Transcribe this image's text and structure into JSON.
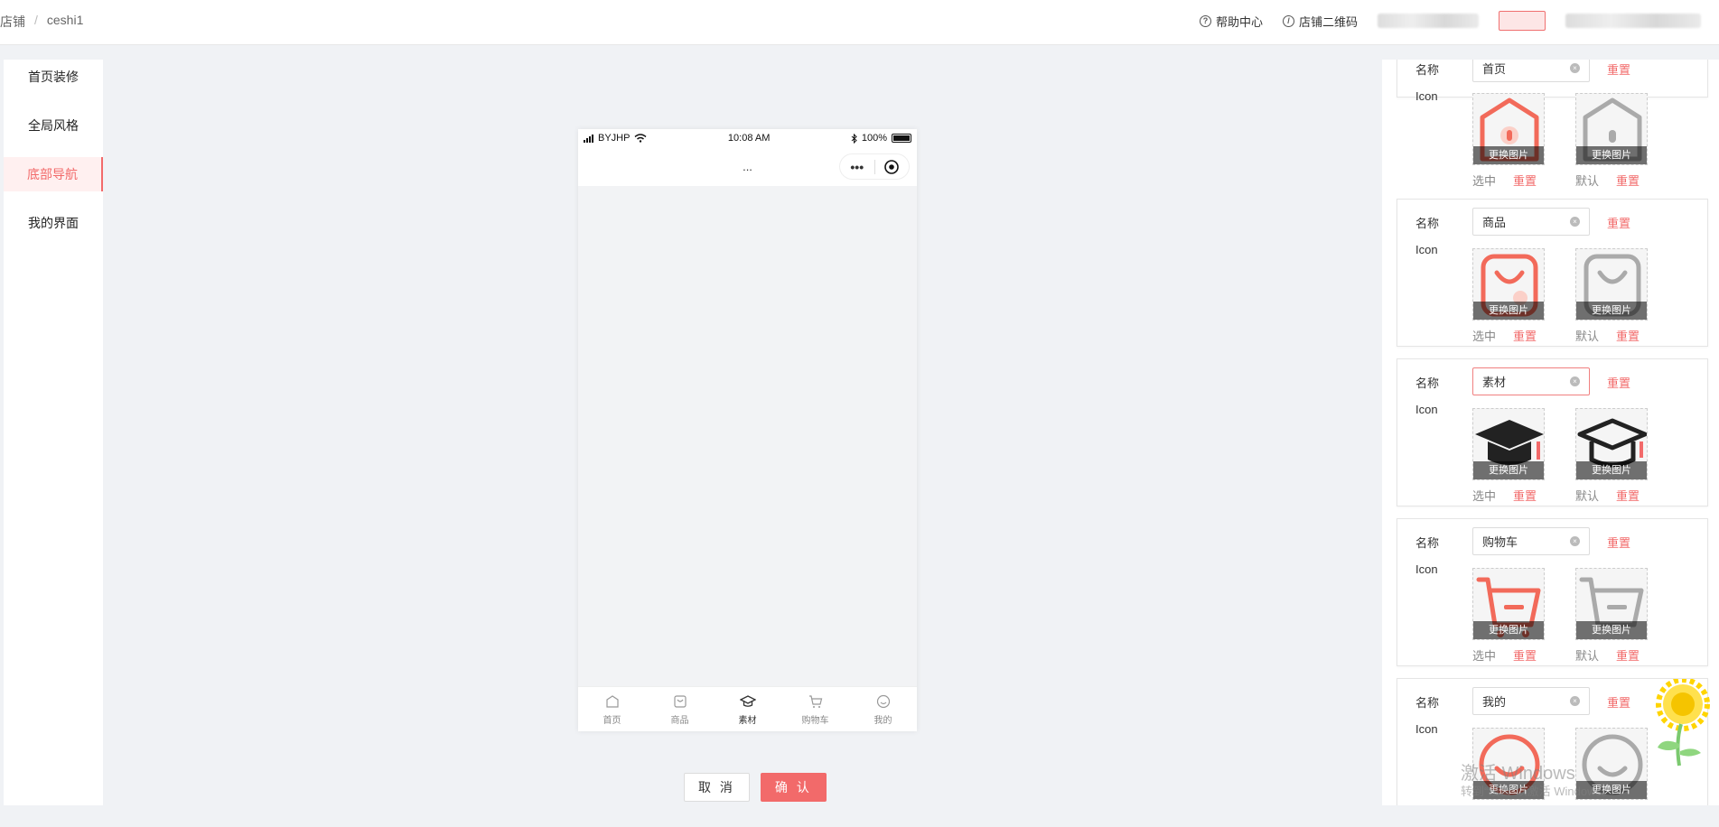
{
  "breadcrumb": {
    "shop": "店铺",
    "sep": "/",
    "page": "ceshi1"
  },
  "header": {
    "help": "帮助中心",
    "qrcode": "店铺二维码"
  },
  "sidebar": {
    "items": [
      {
        "label": "首页装修"
      },
      {
        "label": "全局风格"
      },
      {
        "label": "底部导航",
        "active": true
      },
      {
        "label": "我的界面"
      }
    ]
  },
  "phone": {
    "carrier": "BYJHP",
    "time": "10:08 AM",
    "battery": "100%",
    "nav_title": "...",
    "capsule_more": "•••",
    "tabs": [
      {
        "label": "首页"
      },
      {
        "label": "商品"
      },
      {
        "label": "素材",
        "active": true
      },
      {
        "label": "购物车"
      },
      {
        "label": "我的"
      }
    ]
  },
  "actions": {
    "cancel": "取 消",
    "confirm": "确 认"
  },
  "panel": {
    "name_label": "名称",
    "icon_label": "Icon",
    "reset": "重置",
    "change_image": "更换图片",
    "selected": "选中",
    "default": "默认",
    "items": [
      {
        "name": "首页"
      },
      {
        "name": "商品"
      },
      {
        "name": "素材"
      },
      {
        "name": "购物车"
      },
      {
        "name": "我的"
      }
    ]
  },
  "watermark": {
    "line1": "激活 Windows",
    "line2": "转到“设置”以激活 Windows。"
  },
  "colors": {
    "accent": "#f26a6a",
    "icon_selected": "#f26a5a",
    "icon_default": "#aaaaaa"
  }
}
